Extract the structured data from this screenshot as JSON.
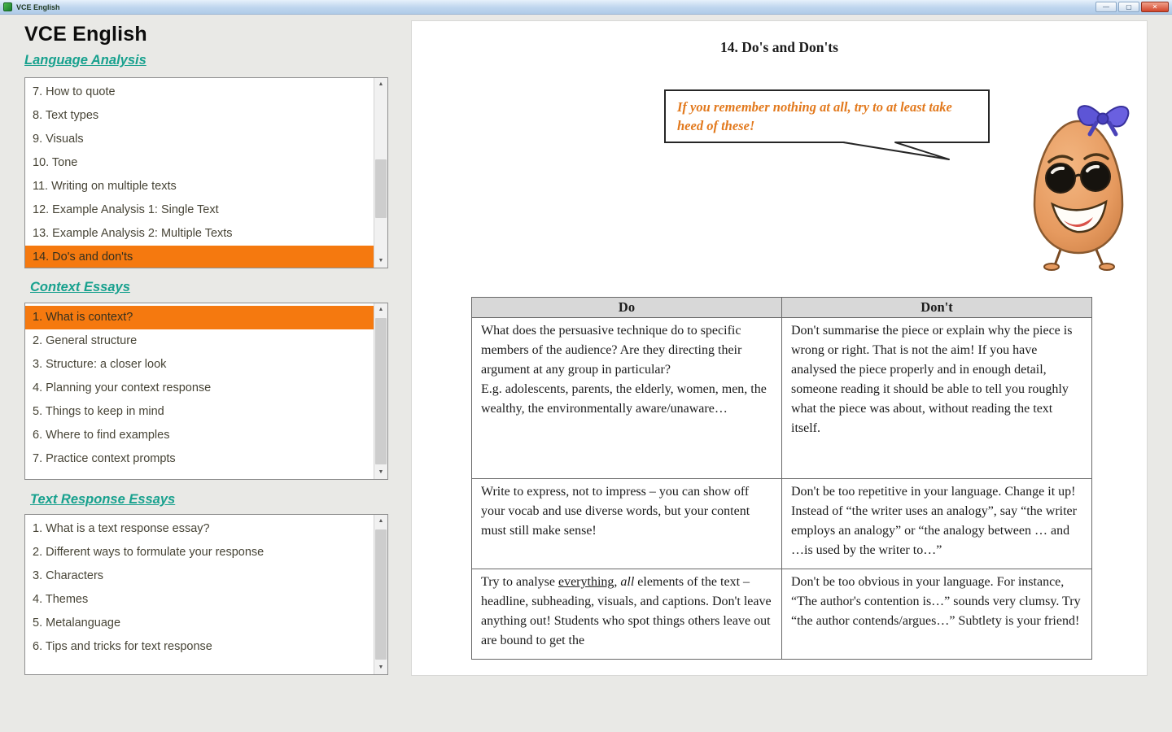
{
  "colors": {
    "accent_orange": "#f5790f",
    "heading_teal": "#18a18e",
    "bubble_orange": "#e2791d"
  },
  "icons": {
    "scroll_up": "▲",
    "scroll_down": "▼",
    "minimize": "—",
    "maximize": "▢",
    "close": "✕"
  },
  "window": {
    "title": "VCE English"
  },
  "sidebar": {
    "app_title": "VCE English",
    "sections": [
      {
        "heading": "Language Analysis",
        "items": [
          {
            "label": "7. How to quote",
            "selected": false
          },
          {
            "label": "8. Text types",
            "selected": false
          },
          {
            "label": "9. Visuals",
            "selected": false
          },
          {
            "label": "10. Tone",
            "selected": false
          },
          {
            "label": "11. Writing on multiple texts",
            "selected": false
          },
          {
            "label": "12. Example Analysis 1: Single Text",
            "selected": false
          },
          {
            "label": "13. Example Analysis 2: Multiple Texts",
            "selected": false
          },
          {
            "label": "14. Do's and don'ts",
            "selected": true
          }
        ]
      },
      {
        "heading": "Context Essays",
        "items": [
          {
            "label": "1. What is context?",
            "selected": true
          },
          {
            "label": "2. General structure",
            "selected": false
          },
          {
            "label": "3. Structure: a closer look",
            "selected": false
          },
          {
            "label": "4. Planning your context response",
            "selected": false
          },
          {
            "label": "5. Things to keep in mind",
            "selected": false
          },
          {
            "label": "6. Where to find examples",
            "selected": false
          },
          {
            "label": "7. Practice context prompts",
            "selected": false
          }
        ]
      },
      {
        "heading": "Text Response Essays",
        "items": [
          {
            "label": "1. What is a text response essay?",
            "selected": false
          },
          {
            "label": "2. Different ways to formulate your response",
            "selected": false
          },
          {
            "label": "3. Characters",
            "selected": false
          },
          {
            "label": "4. Themes",
            "selected": false
          },
          {
            "label": "5. Metalanguage",
            "selected": false
          },
          {
            "label": "6. Tips and tricks for text response",
            "selected": false
          }
        ]
      }
    ]
  },
  "main": {
    "page_title": "14. Do's and Don'ts",
    "speech_bubble_text": "If you remember nothing at all, try to at least take heed of these!",
    "table": {
      "headers": [
        "Do",
        "Don't"
      ],
      "rows": [
        {
          "do": "What does the persuasive technique do to specific members of the audience? Are they directing their argument at any group in particular?\nE.g. adolescents, parents, the elderly, women, men, the wealthy, the environmentally aware/unaware…",
          "dont": "Don't summarise the piece or explain why the piece is wrong or right. That is not the aim! If you have analysed the piece properly and in enough detail, someone reading it should be able to tell you roughly what the piece was about, without reading the text itself."
        },
        {
          "do": "Write to express, not to impress – you can show off your vocab and use diverse words, but your content must still make sense!",
          "dont": "Don't be too repetitive in your language. Change it up! Instead of “the writer uses an analogy”, say “the writer employs an analogy” or “the analogy between … and …is used by the writer to…”"
        },
        {
          "do": "Try to analyse __everything__, _all_ elements of the text – headline, subheading, visuals, and captions. Don't leave anything out! Students who spot things others leave out are bound to get the",
          "dont": "Don't be too obvious in your language. For instance, “The author's contention is…” sounds very clumsy. Try “the author contends/argues…” Subtlety is your friend!"
        }
      ]
    }
  }
}
